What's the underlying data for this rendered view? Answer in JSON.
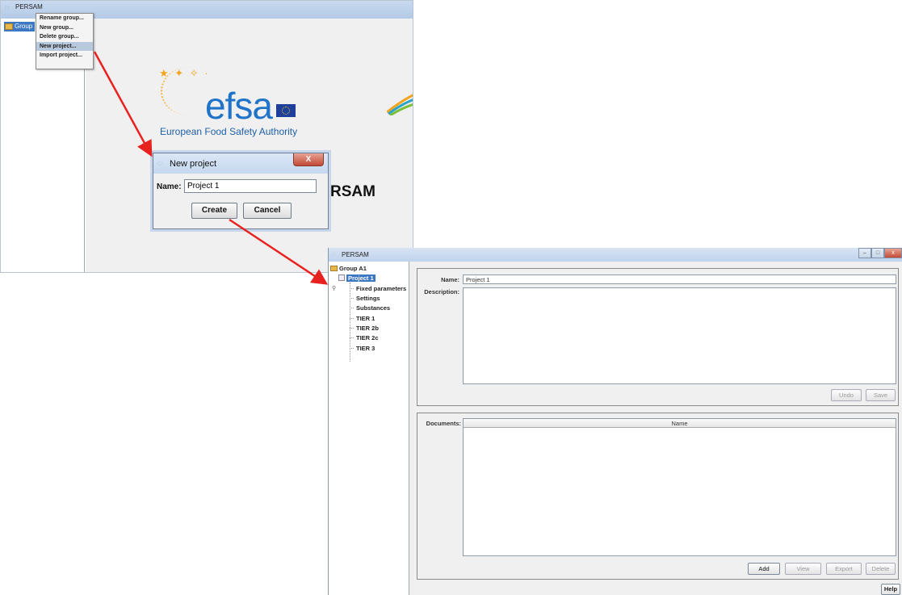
{
  "window1": {
    "title": "PERSAM",
    "tree_group": "Group",
    "context_menu": [
      "Rename group...",
      "New group...",
      "Delete group...",
      "New project...",
      "Import project..."
    ],
    "selected_menu_index": 3,
    "logo_text": "efsa",
    "logo_subtitle": "European Food Safety Authority",
    "splash_text": "RSAM"
  },
  "dialog": {
    "title": "New project",
    "close_label": "X",
    "name_label": "Name:",
    "name_value": "Project 1",
    "create_label": "Create",
    "cancel_label": "Cancel"
  },
  "window2": {
    "title": "PERSAM",
    "group": "Group A1",
    "project": "Project 1",
    "children": [
      "Fixed parameters",
      "Settings",
      "Substances",
      "TIER 1",
      "TIER 2b",
      "TIER 2c",
      "TIER 3"
    ],
    "name_label": "Name:",
    "name_value": "Project 1",
    "description_label": "Description:",
    "undo_label": "Undo",
    "save_label": "Save",
    "documents_label": "Documents:",
    "documents_column": "Name",
    "add_label": "Add",
    "view_label": "View",
    "export_label": "Export",
    "delete_label": "Delete",
    "help_label": "Help"
  },
  "colors": {
    "arrow": "#e8231f",
    "efsa_blue": "#1f73c8",
    "selection": "#3c78c4"
  }
}
